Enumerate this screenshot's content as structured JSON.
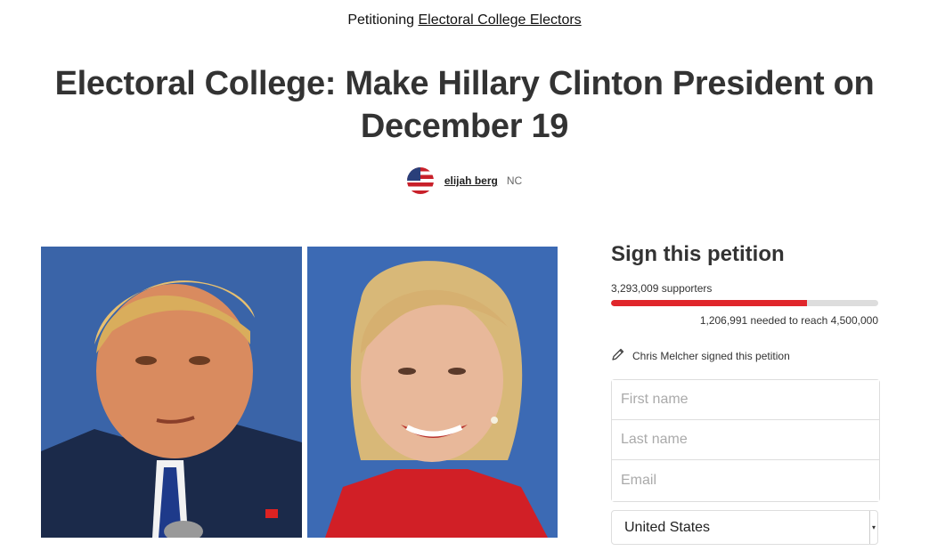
{
  "header": {
    "petitioning_prefix": "Petitioning",
    "target": "Electoral College Electors"
  },
  "petition": {
    "title": "Electoral College: Make Hillary Clinton President on December 19",
    "author_name": "elijah berg",
    "author_location": "NC"
  },
  "sign": {
    "heading": "Sign this petition",
    "supporters": "3,293,009 supporters",
    "needed": "1,206,991 needed to reach 4,500,000",
    "progress_fraction": 0.732,
    "progress_color": "#e0262b",
    "recent_signer": "Chris Melcher signed this petition",
    "recent_icon": "pencil-icon",
    "first_name_placeholder": "First name",
    "last_name_placeholder": "Last name",
    "email_placeholder": "Email",
    "country": "United States"
  }
}
